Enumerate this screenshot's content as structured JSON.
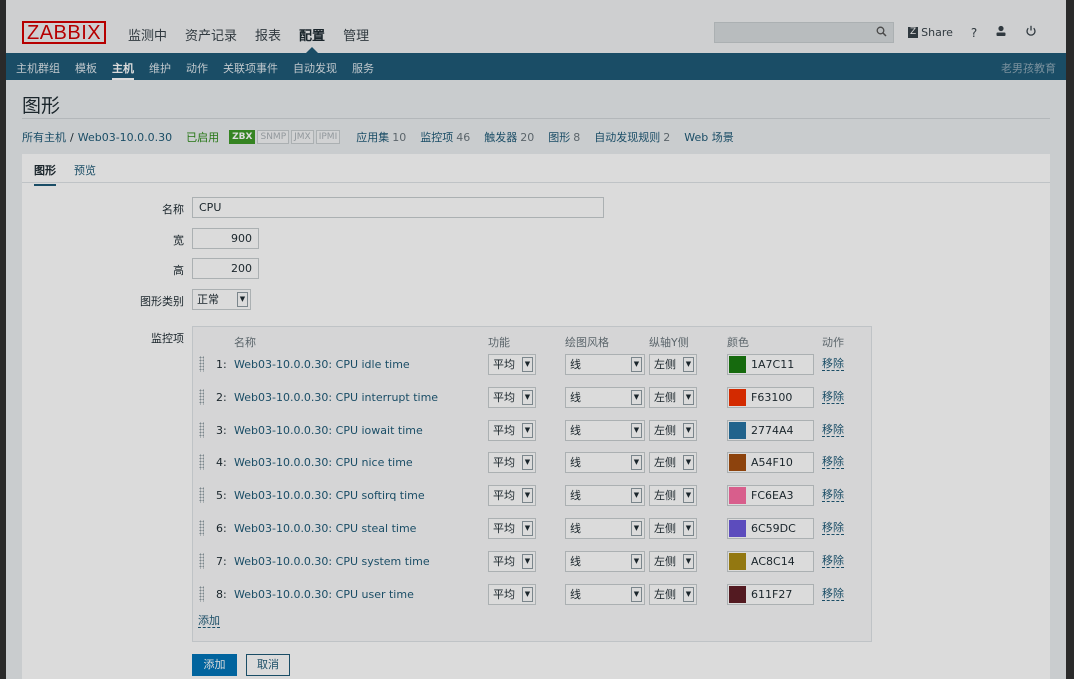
{
  "header": {
    "logo": "ZABBIX",
    "menu": [
      {
        "label": "监测中",
        "active": false
      },
      {
        "label": "资产记录",
        "active": false
      },
      {
        "label": "报表",
        "active": false
      },
      {
        "label": "配置",
        "active": true
      },
      {
        "label": "管理",
        "active": false
      }
    ],
    "search_placeholder": "",
    "share_badge": "Z",
    "share_label": "Share",
    "help_label": "?",
    "icons": [
      "search-icon",
      "help-icon",
      "user-icon",
      "power-icon"
    ]
  },
  "submenu": {
    "items": [
      {
        "label": "主机群组",
        "active": false
      },
      {
        "label": "模板",
        "active": false
      },
      {
        "label": "主机",
        "active": true
      },
      {
        "label": "维护",
        "active": false
      },
      {
        "label": "动作",
        "active": false
      },
      {
        "label": "关联项事件",
        "active": false
      },
      {
        "label": "自动发现",
        "active": false
      },
      {
        "label": "服务",
        "active": false
      }
    ],
    "right_text": "老男孩教育"
  },
  "page_title": "图形",
  "breadcrumb": {
    "all_hosts": "所有主机",
    "separator": "/",
    "host": "Web03-10.0.0.30",
    "status": "已启用",
    "tags": [
      {
        "label": "ZBX",
        "active": true
      },
      {
        "label": "SNMP",
        "active": false
      },
      {
        "label": "JMX",
        "active": false
      },
      {
        "label": "IPMI",
        "active": false
      }
    ],
    "links": [
      {
        "label": "应用集",
        "count": "10"
      },
      {
        "label": "监控项",
        "count": "46"
      },
      {
        "label": "触发器",
        "count": "20"
      },
      {
        "label": "图形",
        "count": "8"
      },
      {
        "label": "自动发现规则",
        "count": "2"
      },
      {
        "label": "Web 场景",
        "count": ""
      }
    ]
  },
  "tabs": [
    "图形",
    "预览"
  ],
  "form": {
    "name_label": "名称",
    "name_value": "CPU",
    "width_label": "宽",
    "width_value": "900",
    "height_label": "高",
    "height_value": "200",
    "type_label": "图形类别",
    "type_value": "正常",
    "items_label": "监控项"
  },
  "items_table": {
    "headers": {
      "name": "名称",
      "function": "功能",
      "style": "绘图风格",
      "yaxis": "纵轴Y侧",
      "color": "颜色",
      "action": "动作"
    },
    "rows": [
      {
        "num": "1:",
        "name": "Web03-10.0.0.30: CPU idle time",
        "function": "平均",
        "style": "线",
        "yaxis": "左侧",
        "color": "1A7C11",
        "remove": "移除"
      },
      {
        "num": "2:",
        "name": "Web03-10.0.0.30: CPU interrupt time",
        "function": "平均",
        "style": "线",
        "yaxis": "左侧",
        "color": "F63100",
        "remove": "移除"
      },
      {
        "num": "3:",
        "name": "Web03-10.0.0.30: CPU iowait time",
        "function": "平均",
        "style": "线",
        "yaxis": "左侧",
        "color": "2774A4",
        "remove": "移除"
      },
      {
        "num": "4:",
        "name": "Web03-10.0.0.30: CPU nice time",
        "function": "平均",
        "style": "线",
        "yaxis": "左侧",
        "color": "A54F10",
        "remove": "移除"
      },
      {
        "num": "5:",
        "name": "Web03-10.0.0.30: CPU softirq time",
        "function": "平均",
        "style": "线",
        "yaxis": "左侧",
        "color": "FC6EA3",
        "remove": "移除"
      },
      {
        "num": "6:",
        "name": "Web03-10.0.0.30: CPU steal time",
        "function": "平均",
        "style": "线",
        "yaxis": "左侧",
        "color": "6C59DC",
        "remove": "移除"
      },
      {
        "num": "7:",
        "name": "Web03-10.0.0.30: CPU system time",
        "function": "平均",
        "style": "线",
        "yaxis": "左侧",
        "color": "AC8C14",
        "remove": "移除"
      },
      {
        "num": "8:",
        "name": "Web03-10.0.0.30: CPU user time",
        "function": "平均",
        "style": "线",
        "yaxis": "左侧",
        "color": "611F27",
        "remove": "移除"
      }
    ],
    "add_link": "添加"
  },
  "buttons": {
    "add": "添加",
    "cancel": "取消"
  }
}
